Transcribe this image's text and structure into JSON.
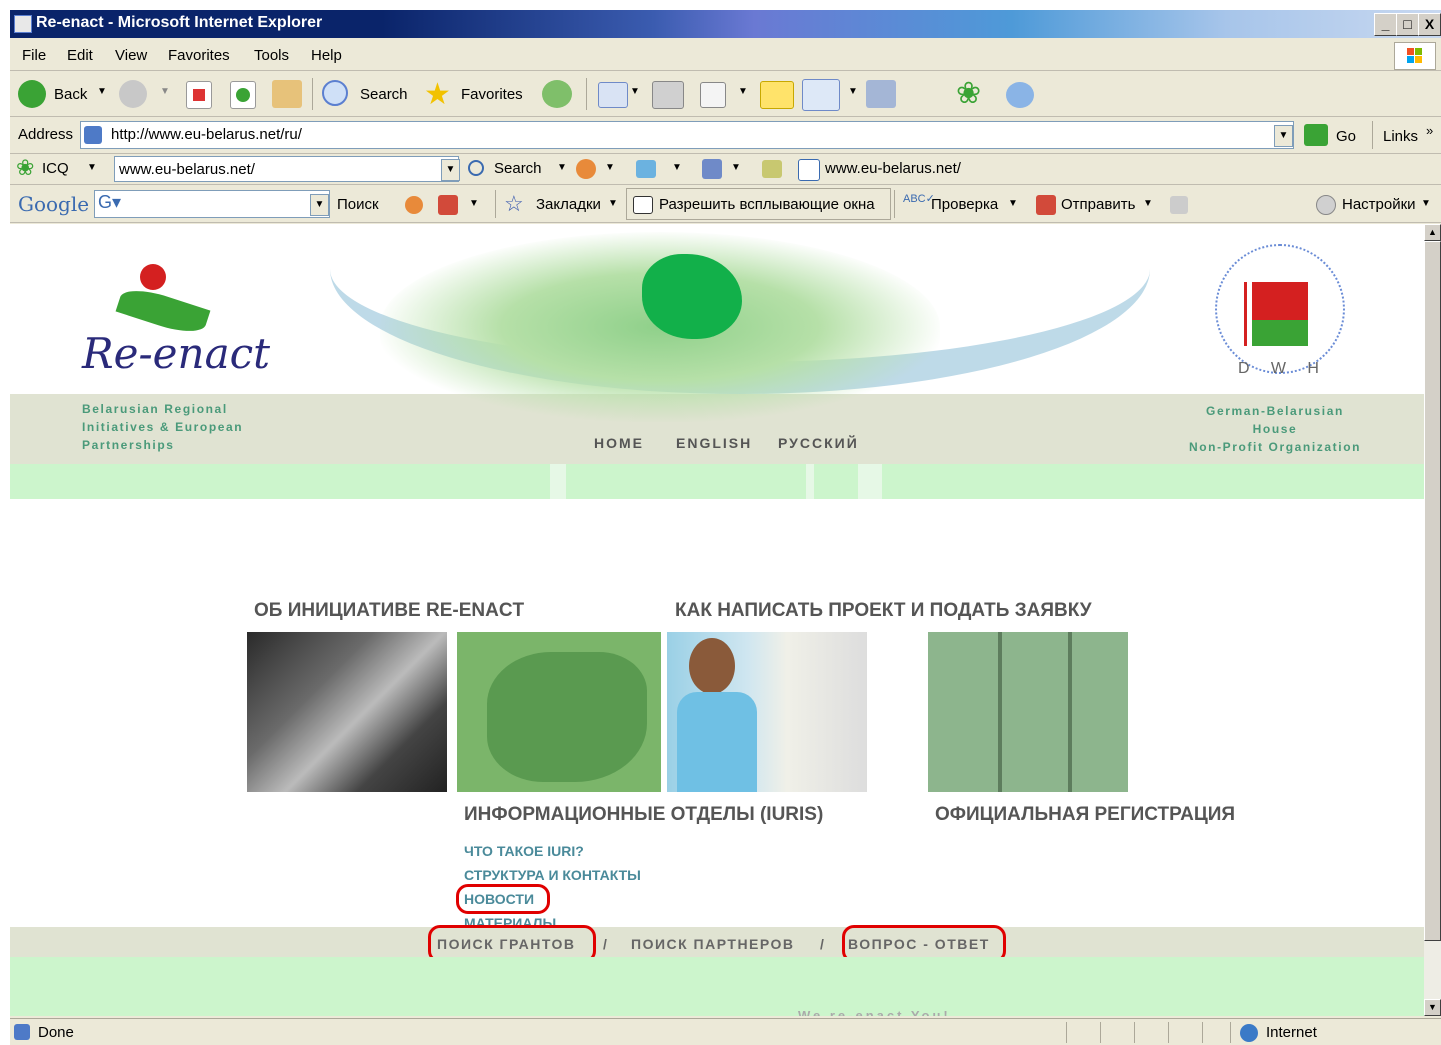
{
  "window": {
    "title": "Re-enact - Microsoft Internet Explorer",
    "btn_min": "_",
    "btn_max": "□",
    "btn_close": "X"
  },
  "menu": [
    "File",
    "Edit",
    "View",
    "Favorites",
    "Tools",
    "Help"
  ],
  "toolbar": {
    "back": "Back",
    "search": "Search",
    "favorites": "Favorites"
  },
  "address": {
    "label": "Address",
    "url": "http://www.eu-belarus.net/ru/",
    "go": "Go",
    "links": "Links"
  },
  "icqbar": {
    "icq": "ICQ",
    "url": "www.eu-belarus.net/",
    "search": "Search",
    "url2": "www.eu-belarus.net/"
  },
  "googlebar": {
    "logo": "Google",
    "search": "Поиск",
    "bookmarks": "Закладки",
    "popups": "Разрешить всплывающие окна",
    "check": "Проверка",
    "send": "Отправить",
    "settings": "Настройки"
  },
  "page": {
    "logo_text": "Re-enact",
    "tagline_left": [
      "Belarusian Regional",
      "Initiatives & European",
      "Partnerships"
    ],
    "dwh": "D   W   H",
    "tagline_right": [
      "German-Belarusian",
      "House",
      "Non-Profit Organization"
    ],
    "nav": [
      "HOME",
      "ENGLISH",
      "РУССКИЙ"
    ],
    "section1": "ОБ ИНИЦИАТИВЕ RE-ENACT",
    "section2": "КАК НАПИСАТЬ ПРОЕКТ И ПОДАТЬ ЗАЯВКУ",
    "section3": "ИНФОРМАЦИОННЫЕ ОТДЕЛЫ (IURIS)",
    "section4": "ОФИЦИАЛЬНАЯ РЕГИСТРАЦИЯ",
    "links": [
      "ЧТО ТАКОЕ IURI?",
      "СТРУКТУРА И КОНТАКТЫ",
      "НОВОСТИ",
      "МАТЕРИАЛЫ"
    ],
    "bottom_links": [
      "ПОИСК ГРАНТОВ",
      "ПОИСК ПАРТНЕРОВ",
      "ВОПРОС - ОТВЕТ"
    ],
    "bottom_sep": "/",
    "footer": "We re-enact You!"
  },
  "status": {
    "text": "Done",
    "zone": "Internet"
  }
}
